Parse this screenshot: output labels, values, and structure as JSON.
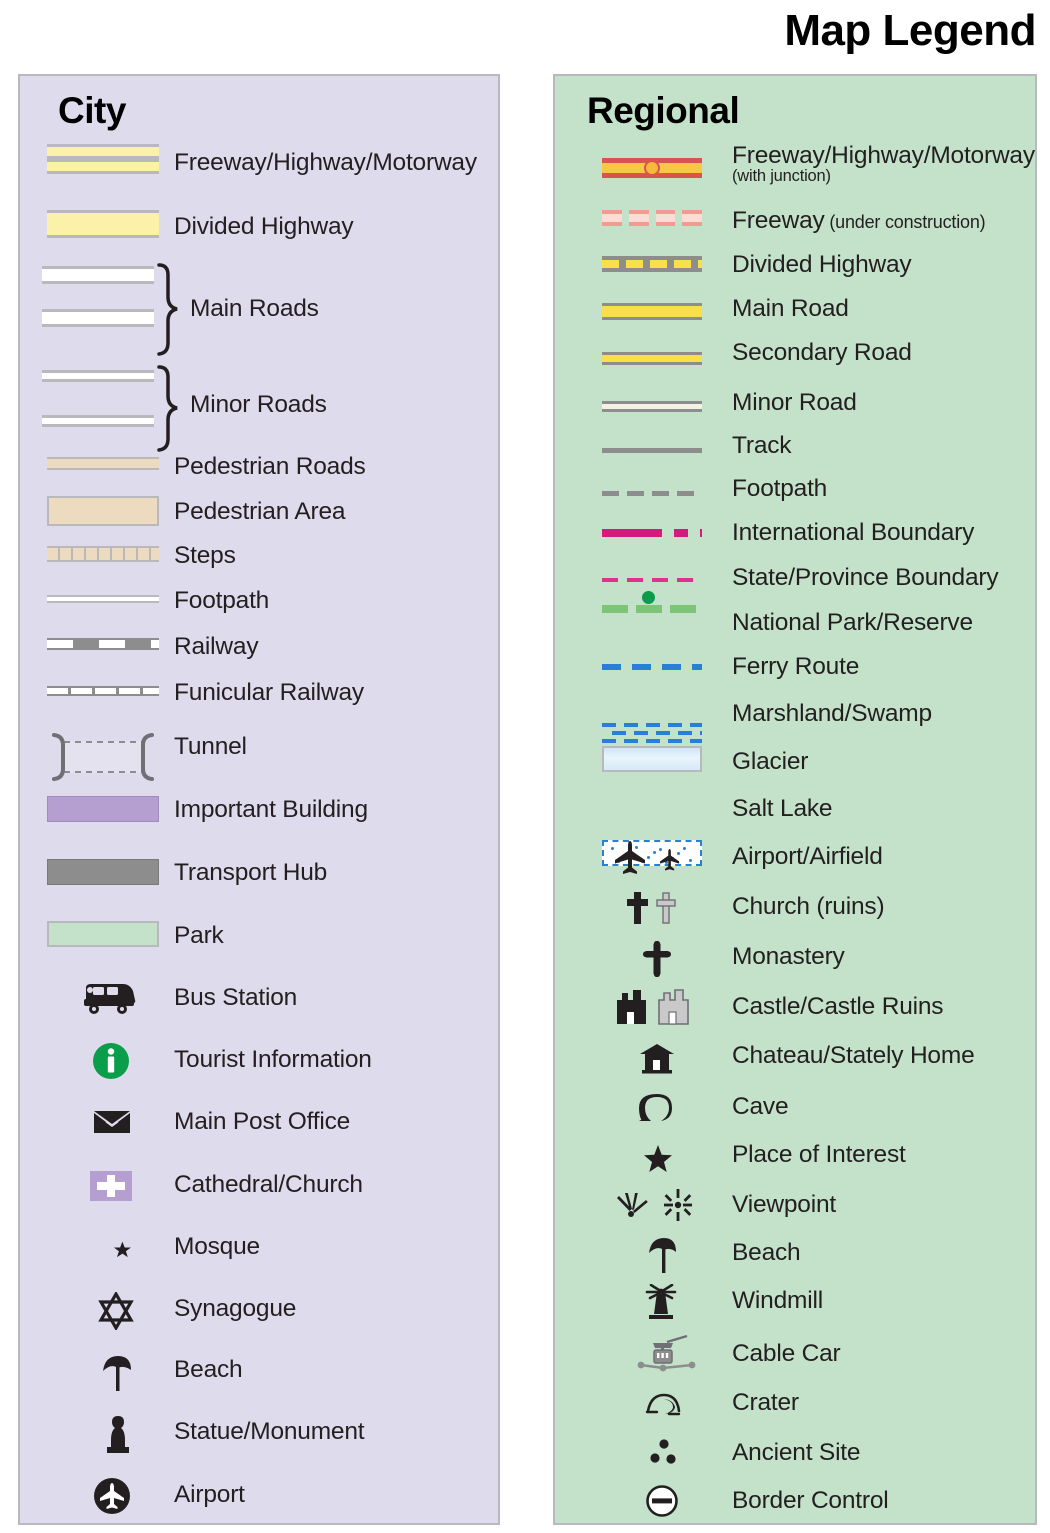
{
  "header": {
    "title": "Map Legend"
  },
  "city": {
    "heading": "City",
    "items": [
      {
        "label": "Freeway/Highway/Motorway",
        "symbol": "freeway-double-yellow"
      },
      {
        "label": "Divided Highway",
        "symbol": "divided-highway-yellow"
      },
      {
        "label": "Main Roads",
        "symbol": "main-roads-white-pair-brace"
      },
      {
        "label": "Minor Roads",
        "symbol": "minor-roads-white-pair-brace"
      },
      {
        "label": "Pedestrian Roads",
        "symbol": "pedestrian-road-tan"
      },
      {
        "label": "Pedestrian Area",
        "symbol": "pedestrian-area-tan"
      },
      {
        "label": "Steps",
        "symbol": "steps-hatched"
      },
      {
        "label": "Footpath",
        "symbol": "footpath-white"
      },
      {
        "label": "Railway",
        "symbol": "railway-dashed"
      },
      {
        "label": "Funicular Railway",
        "symbol": "funicular-ticked"
      },
      {
        "label": "Tunnel",
        "symbol": "tunnel-brackets"
      },
      {
        "label": "Important Building",
        "symbol": "important-building-purple"
      },
      {
        "label": "Transport Hub",
        "symbol": "transport-hub-grey"
      },
      {
        "label": "Park",
        "symbol": "park-green"
      },
      {
        "label": "Bus Station",
        "symbol": "bus-icon"
      },
      {
        "label": "Tourist Information",
        "symbol": "tourist-information-icon"
      },
      {
        "label": "Main Post Office",
        "symbol": "envelope-icon"
      },
      {
        "label": "Cathedral/Church",
        "symbol": "cross-on-purple-icon"
      },
      {
        "label": "Mosque",
        "symbol": "star-and-crescent-icon"
      },
      {
        "label": "Synagogue",
        "symbol": "star-of-david-icon"
      },
      {
        "label": "Beach",
        "symbol": "beach-umbrella-icon"
      },
      {
        "label": "Statue/Monument",
        "symbol": "statue-icon"
      },
      {
        "label": "Airport",
        "symbol": "airport-circle-icon"
      }
    ]
  },
  "regional": {
    "heading": "Regional",
    "items": [
      {
        "label": "Freeway/Highway/Motorway",
        "sublabel": "(with junction)",
        "symbol": "freeway-red-junction"
      },
      {
        "label": "Freeway",
        "inline_note": "(under construction)",
        "symbol": "freeway-under-construction"
      },
      {
        "label": "Divided Highway",
        "symbol": "divided-highway-grey-yellow"
      },
      {
        "label": "Main Road",
        "symbol": "main-road-yellow"
      },
      {
        "label": "Secondary Road",
        "symbol": "secondary-road-yellow"
      },
      {
        "label": "Minor Road",
        "symbol": "minor-road-cream"
      },
      {
        "label": "Track",
        "symbol": "track-grey-line"
      },
      {
        "label": "Footpath",
        "symbol": "footpath-grey-dashed"
      },
      {
        "label": "International Boundary",
        "symbol": "international-boundary-magenta"
      },
      {
        "label": "State/Province Boundary",
        "symbol": "state-boundary-pink-dashed"
      },
      {
        "label": "National Park/Reserve",
        "symbol": "national-park-green-dotted"
      },
      {
        "label": "Ferry Route",
        "symbol": "ferry-route-blue-dashed"
      },
      {
        "label": "Marshland/Swamp",
        "symbol": "marshland-blue-hatch"
      },
      {
        "label": "Glacier",
        "symbol": "glacier-blue-gradient"
      },
      {
        "label": "Salt Lake",
        "symbol": "salt-lake-stippled"
      },
      {
        "label": "Airport/Airfield",
        "symbol": "airplane-pair-icon"
      },
      {
        "label": "Church (ruins)",
        "symbol": "cross-pair-icon"
      },
      {
        "label": "Monastery",
        "symbol": "monastery-cross-icon"
      },
      {
        "label": "Castle/Castle Ruins",
        "symbol": "castle-pair-icon"
      },
      {
        "label": "Chateau/Stately Home",
        "symbol": "chateau-icon"
      },
      {
        "label": "Cave",
        "symbol": "cave-icon"
      },
      {
        "label": "Place of Interest",
        "symbol": "star-icon"
      },
      {
        "label": "Viewpoint",
        "symbol": "viewpoint-pair-icon"
      },
      {
        "label": "Beach",
        "symbol": "beach-umbrella-icon"
      },
      {
        "label": "Windmill",
        "symbol": "windmill-icon"
      },
      {
        "label": "Cable Car",
        "symbol": "cable-car-icon"
      },
      {
        "label": "Crater",
        "symbol": "crater-icon"
      },
      {
        "label": "Ancient Site",
        "symbol": "ancient-site-dots-icon"
      },
      {
        "label": "Border Control",
        "symbol": "border-control-icon"
      }
    ]
  },
  "colors": {
    "city_panel_bg": "#dedbec",
    "regional_panel_bg": "#c4e2ca",
    "panel_border": "#b9b9bd",
    "road_yellow": "#fbf1a8",
    "regional_yellow": "#f9e04a",
    "freeway_red": "#d9534f",
    "pedestrian_tan": "#ecdbbe",
    "important_building_purple": "#b49fd0",
    "transport_hub_grey": "#8d8d8d",
    "magenta_boundary": "#d6197d",
    "pink_boundary": "#e0318c",
    "park_green": "#7cc576",
    "ferry_blue": "#2a7fd4",
    "text": "#231f20"
  }
}
